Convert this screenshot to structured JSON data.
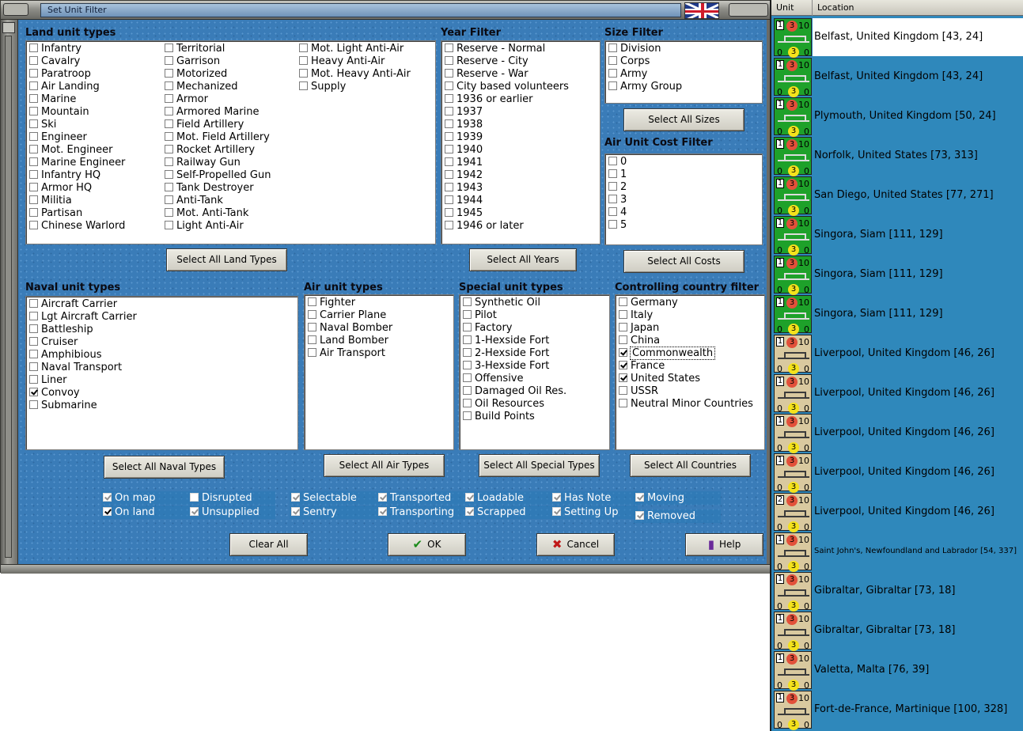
{
  "window": {
    "title": "Set Unit Filter",
    "flag_icon": "uk-flag-icon"
  },
  "land": {
    "title": "Land unit types",
    "col1": [
      {
        "label": "Infantry",
        "checked": false
      },
      {
        "label": "Cavalry",
        "checked": false
      },
      {
        "label": "Paratroop",
        "checked": false
      },
      {
        "label": "Air Landing",
        "checked": false
      },
      {
        "label": "Marine",
        "checked": false
      },
      {
        "label": "Mountain",
        "checked": false
      },
      {
        "label": "Ski",
        "checked": false
      },
      {
        "label": "Engineer",
        "checked": false
      },
      {
        "label": "Mot. Engineer",
        "checked": false
      },
      {
        "label": "Marine Engineer",
        "checked": false
      },
      {
        "label": "Infantry HQ",
        "checked": false
      },
      {
        "label": "Armor HQ",
        "checked": false
      },
      {
        "label": "Militia",
        "checked": false
      },
      {
        "label": "Partisan",
        "checked": false
      },
      {
        "label": "Chinese Warlord",
        "checked": false
      }
    ],
    "col2": [
      {
        "label": "Territorial",
        "checked": false
      },
      {
        "label": "Garrison",
        "checked": false
      },
      {
        "label": "Motorized",
        "checked": false
      },
      {
        "label": "Mechanized",
        "checked": false
      },
      {
        "label": "Armor",
        "checked": false
      },
      {
        "label": "Armored Marine",
        "checked": false
      },
      {
        "label": "Field Artillery",
        "checked": false
      },
      {
        "label": "Mot. Field Artillery",
        "checked": false
      },
      {
        "label": "Rocket Artillery",
        "checked": false
      },
      {
        "label": "Railway Gun",
        "checked": false
      },
      {
        "label": "Self-Propelled Gun",
        "checked": false
      },
      {
        "label": "Tank Destroyer",
        "checked": false
      },
      {
        "label": "Anti-Tank",
        "checked": false
      },
      {
        "label": "Mot. Anti-Tank",
        "checked": false
      },
      {
        "label": "Light Anti-Air",
        "checked": false
      }
    ],
    "col3": [
      {
        "label": "Mot. Light Anti-Air",
        "checked": false
      },
      {
        "label": "Heavy Anti-Air",
        "checked": false
      },
      {
        "label": "Mot. Heavy Anti-Air",
        "checked": false
      },
      {
        "label": "Supply",
        "checked": false
      }
    ],
    "button": "Select All Land Types"
  },
  "year": {
    "title": "Year Filter",
    "items": [
      {
        "label": "Reserve  -  Normal",
        "checked": false
      },
      {
        "label": "Reserve  -  City",
        "checked": false
      },
      {
        "label": "Reserve  -  War",
        "checked": false
      },
      {
        "label": "City based volunteers",
        "checked": false
      },
      {
        "label": "1936 or earlier",
        "checked": false
      },
      {
        "label": "1937",
        "checked": false
      },
      {
        "label": "1938",
        "checked": false
      },
      {
        "label": "1939",
        "checked": false
      },
      {
        "label": "1940",
        "checked": false
      },
      {
        "label": "1941",
        "checked": false
      },
      {
        "label": "1942",
        "checked": false
      },
      {
        "label": "1943",
        "checked": false
      },
      {
        "label": "1944",
        "checked": false
      },
      {
        "label": "1945",
        "checked": false
      },
      {
        "label": "1946 or later",
        "checked": false
      }
    ],
    "button": "Select All Years"
  },
  "size": {
    "title": "Size Filter",
    "items": [
      {
        "label": "Division",
        "checked": false
      },
      {
        "label": "Corps",
        "checked": false
      },
      {
        "label": "Army",
        "checked": false
      },
      {
        "label": "Army Group",
        "checked": false
      }
    ],
    "button": "Select All Sizes"
  },
  "cost": {
    "title": "Air Unit Cost Filter",
    "items": [
      {
        "label": "0",
        "checked": false
      },
      {
        "label": "1",
        "checked": false
      },
      {
        "label": "2",
        "checked": false
      },
      {
        "label": "3",
        "checked": false
      },
      {
        "label": "4",
        "checked": false
      },
      {
        "label": "5",
        "checked": false
      }
    ],
    "button": "Select All Costs"
  },
  "naval": {
    "title": "Naval unit types",
    "items": [
      {
        "label": "Aircraft Carrier",
        "checked": false
      },
      {
        "label": "Lgt Aircraft Carrier",
        "checked": false
      },
      {
        "label": "Battleship",
        "checked": false
      },
      {
        "label": "Cruiser",
        "checked": false
      },
      {
        "label": "Amphibious",
        "checked": false
      },
      {
        "label": "Naval Transport",
        "checked": false
      },
      {
        "label": "Liner",
        "checked": false
      },
      {
        "label": "Convoy",
        "checked": true
      },
      {
        "label": "Submarine",
        "checked": false
      }
    ],
    "button": "Select All Naval Types"
  },
  "air": {
    "title": "Air unit types",
    "items": [
      {
        "label": "Fighter",
        "checked": false
      },
      {
        "label": "Carrier Plane",
        "checked": false
      },
      {
        "label": "Naval Bomber",
        "checked": false
      },
      {
        "label": "Land Bomber",
        "checked": false
      },
      {
        "label": "Air Transport",
        "checked": false
      }
    ],
    "button": "Select All Air Types"
  },
  "special": {
    "title": "Special unit types",
    "items": [
      {
        "label": "Synthetic Oil",
        "checked": false
      },
      {
        "label": "Pilot",
        "checked": false
      },
      {
        "label": "Factory",
        "checked": false
      },
      {
        "label": "1-Hexside Fort",
        "checked": false
      },
      {
        "label": "2-Hexside Fort",
        "checked": false
      },
      {
        "label": "3-Hexside Fort",
        "checked": false
      },
      {
        "label": "Offensive",
        "checked": false
      },
      {
        "label": "Damaged Oil Res.",
        "checked": false
      },
      {
        "label": "Oil Resources",
        "checked": false
      },
      {
        "label": "Build Points",
        "checked": false
      }
    ],
    "button": "Select All Special Types"
  },
  "country": {
    "title": "Controlling country filter",
    "items": [
      {
        "label": "Germany",
        "checked": false
      },
      {
        "label": "Italy",
        "checked": false
      },
      {
        "label": "Japan",
        "checked": false
      },
      {
        "label": "China",
        "checked": false
      },
      {
        "label": "Commonwealth",
        "checked": true
      },
      {
        "label": "France",
        "checked": true
      },
      {
        "label": "United States",
        "checked": true
      },
      {
        "label": "USSR",
        "checked": false
      },
      {
        "label": "Neutral Minor Countries",
        "checked": false
      }
    ],
    "button": "Select All Countries"
  },
  "flags": {
    "row1": [
      {
        "label": "On map",
        "checked": true,
        "dim": true
      },
      {
        "label": "Disrupted",
        "checked": false
      },
      {
        "label": "Selectable",
        "checked": true,
        "dim": true
      },
      {
        "label": "Transported",
        "checked": true,
        "dim": true
      },
      {
        "label": "Loadable",
        "checked": true,
        "dim": true
      },
      {
        "label": "Has Note",
        "checked": true,
        "dim": true
      },
      {
        "label": "Moving",
        "checked": true,
        "dim": true
      }
    ],
    "row2": [
      {
        "label": "On land",
        "checked": true
      },
      {
        "label": "Unsupplied",
        "checked": true,
        "dim": true
      },
      {
        "label": "Sentry",
        "checked": true,
        "dim": true
      },
      {
        "label": "Transporting",
        "checked": true,
        "dim": true
      },
      {
        "label": "Scrapped",
        "checked": true,
        "dim": true
      },
      {
        "label": "Setting Up",
        "checked": true,
        "dim": true
      },
      {
        "label": "Removed",
        "checked": true,
        "dim": true
      }
    ]
  },
  "buttons": {
    "clear": "Clear All",
    "ok": "OK",
    "cancel": "Cancel",
    "help": "Help"
  },
  "list": {
    "header_unit": "Unit",
    "header_location": "Location",
    "rows": [
      {
        "a": "1",
        "b": "3",
        "c": "10",
        "d": "0",
        "e": "3",
        "f": "0",
        "color": "green",
        "loc": "Belfast, United Kingdom [43, 24]",
        "selected": true
      },
      {
        "a": "1",
        "b": "3",
        "c": "10",
        "d": "0",
        "e": "3",
        "f": "0",
        "color": "green",
        "loc": "Belfast, United Kingdom [43, 24]"
      },
      {
        "a": "1",
        "b": "3",
        "c": "10",
        "d": "0",
        "e": "3",
        "f": "0",
        "color": "green",
        "loc": "Plymouth, United Kingdom [50, 24]"
      },
      {
        "a": "1",
        "b": "3",
        "c": "10",
        "d": "0",
        "e": "3",
        "f": "0",
        "color": "green",
        "loc": "Norfolk, United States [73, 313]"
      },
      {
        "a": "1",
        "b": "3",
        "c": "10",
        "d": "0",
        "e": "3",
        "f": "0",
        "color": "green",
        "loc": "San Diego, United States [77, 271]"
      },
      {
        "a": "1",
        "b": "3",
        "c": "10",
        "d": "0",
        "e": "3",
        "f": "0",
        "color": "green",
        "loc": "Singora, Siam [111, 129]"
      },
      {
        "a": "1",
        "b": "3",
        "c": "10",
        "d": "0",
        "e": "3",
        "f": "0",
        "color": "green",
        "loc": "Singora, Siam [111, 129]"
      },
      {
        "a": "1",
        "b": "3",
        "c": "10",
        "d": "0",
        "e": "3",
        "f": "0",
        "color": "green",
        "loc": "Singora, Siam [111, 129]"
      },
      {
        "a": "1",
        "b": "3",
        "c": "10",
        "d": "0",
        "e": "3",
        "f": "0",
        "color": "tan",
        "loc": "Liverpool, United Kingdom [46, 26]"
      },
      {
        "a": "1",
        "b": "3",
        "c": "10",
        "d": "0",
        "e": "3",
        "f": "0",
        "color": "tan",
        "loc": "Liverpool, United Kingdom [46, 26]"
      },
      {
        "a": "1",
        "b": "3",
        "c": "10",
        "d": "0",
        "e": "3",
        "f": "0",
        "color": "tan",
        "loc": "Liverpool, United Kingdom [46, 26]"
      },
      {
        "a": "1",
        "b": "3",
        "c": "10",
        "d": "0",
        "e": "3",
        "f": "0",
        "color": "tan",
        "loc": "Liverpool, United Kingdom [46, 26]"
      },
      {
        "a": "2",
        "b": "3",
        "c": "10",
        "d": "0",
        "e": "3",
        "f": "0",
        "color": "tan",
        "loc": "Liverpool, United Kingdom [46, 26]"
      },
      {
        "a": "1",
        "b": "3",
        "c": "10",
        "d": "0",
        "e": "3",
        "f": "0",
        "color": "tan",
        "loc": "Saint John's, Newfoundland and Labrador [54, 337]",
        "small": true
      },
      {
        "a": "1",
        "b": "3",
        "c": "10",
        "d": "0",
        "e": "3",
        "f": "0",
        "color": "tan",
        "loc": "Gibraltar, Gibraltar [73, 18]"
      },
      {
        "a": "1",
        "b": "3",
        "c": "10",
        "d": "0",
        "e": "3",
        "f": "0",
        "color": "tan",
        "loc": "Gibraltar, Gibraltar [73, 18]"
      },
      {
        "a": "1",
        "b": "3",
        "c": "10",
        "d": "0",
        "e": "3",
        "f": "0",
        "color": "tan",
        "loc": "Valetta, Malta [76, 39]"
      },
      {
        "a": "1",
        "b": "3",
        "c": "10",
        "d": "0",
        "e": "3",
        "f": "0",
        "color": "tan",
        "loc": "Fort-de-France, Martinique [100, 328]"
      }
    ]
  }
}
